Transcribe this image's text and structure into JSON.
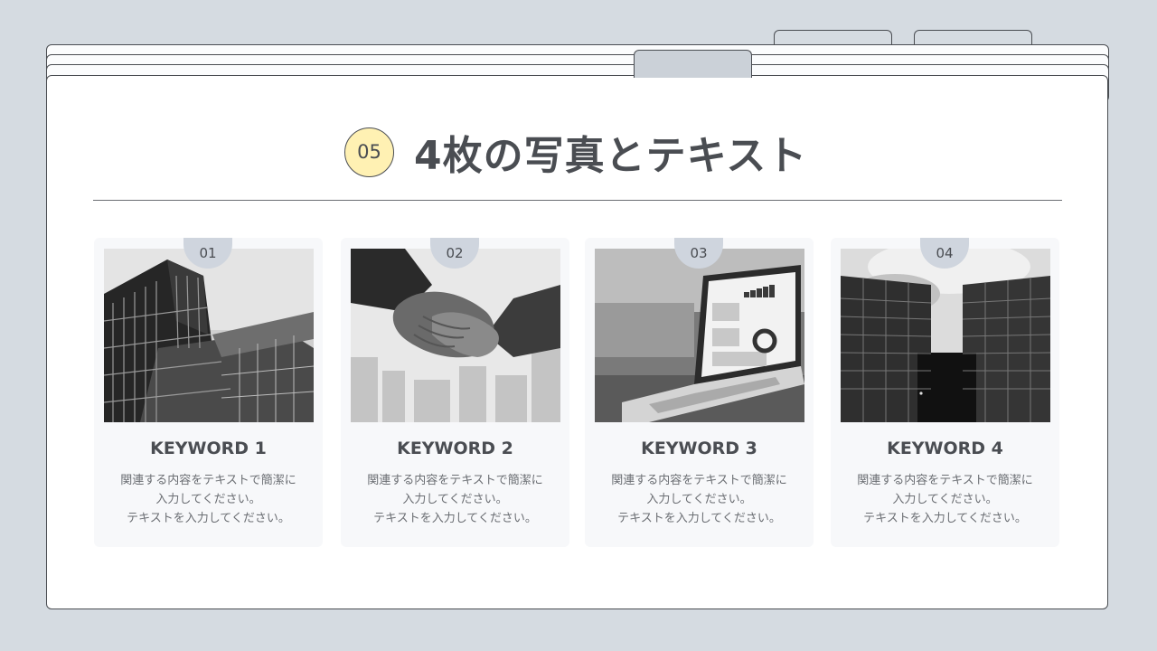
{
  "slide": {
    "number": "05",
    "title": "4枚の写真とテキスト"
  },
  "cards": [
    {
      "number": "01",
      "keyword": "KEYWORD 1",
      "desc_line1": "関連する内容をテキストで簡潔に",
      "desc_line2": "入力してください。",
      "desc_line3": "テキストを入力してください。",
      "image": "skyscraper-photo"
    },
    {
      "number": "02",
      "keyword": "KEYWORD 2",
      "desc_line1": "関連する内容をテキストで簡潔に",
      "desc_line2": "入力してください。",
      "desc_line3": "テキストを入力してください。",
      "image": "handshake-photo"
    },
    {
      "number": "03",
      "keyword": "KEYWORD 3",
      "desc_line1": "関連する内容をテキストで簡潔に",
      "desc_line2": "入力してください。",
      "desc_line3": "テキストを入力してください。",
      "image": "laptop-photo"
    },
    {
      "number": "04",
      "keyword": "KEYWORD 4",
      "desc_line1": "関連する内容をテキストで簡潔に",
      "desc_line2": "入力してください。",
      "desc_line3": "テキストを入力してください。",
      "image": "towers-photo"
    }
  ],
  "colors": {
    "background": "#d5dbe1",
    "sheet": "#ffffff",
    "badge": "#fff1b3",
    "number_tab": "#cfd5de",
    "text": "#4a4d52"
  }
}
